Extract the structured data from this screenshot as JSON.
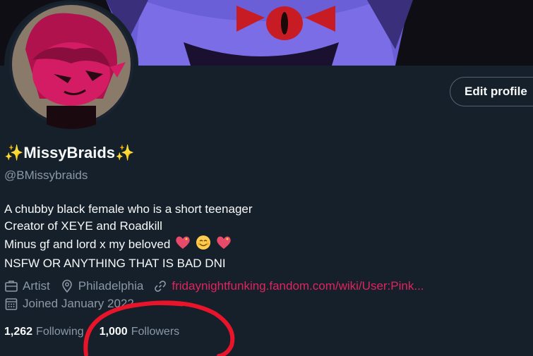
{
  "profile": {
    "display_name": "MissyBraids",
    "name_emoji_left": "✨",
    "name_emoji_right": "✨",
    "handle": "@BMissybraids",
    "edit_button_label": "Edit profile",
    "bio": [
      "A chubby black female who is a short teenager",
      "Creator of XEYE and Roadkill",
      "Minus gf and lord x my beloved",
      "NSFW OR ANYTHING THAT IS BAD DNI"
    ],
    "meta": {
      "category": "Artist",
      "location": "Philadelphia",
      "website": "fridaynightfunking.fandom.com/wiki/User:Pink...",
      "joined": "Joined January 2022"
    },
    "following_count": "1,262",
    "following_label": "Following",
    "followers_count": "1,000",
    "followers_label": "Followers"
  },
  "icons": {
    "category": "briefcase-icon",
    "location": "map-pin-icon",
    "website": "link-icon",
    "joined": "calendar-icon"
  },
  "colors": {
    "background": "#15202b",
    "link": "#e0245e",
    "secondary_text": "#8b98a5",
    "annotation": "#e8142a"
  }
}
